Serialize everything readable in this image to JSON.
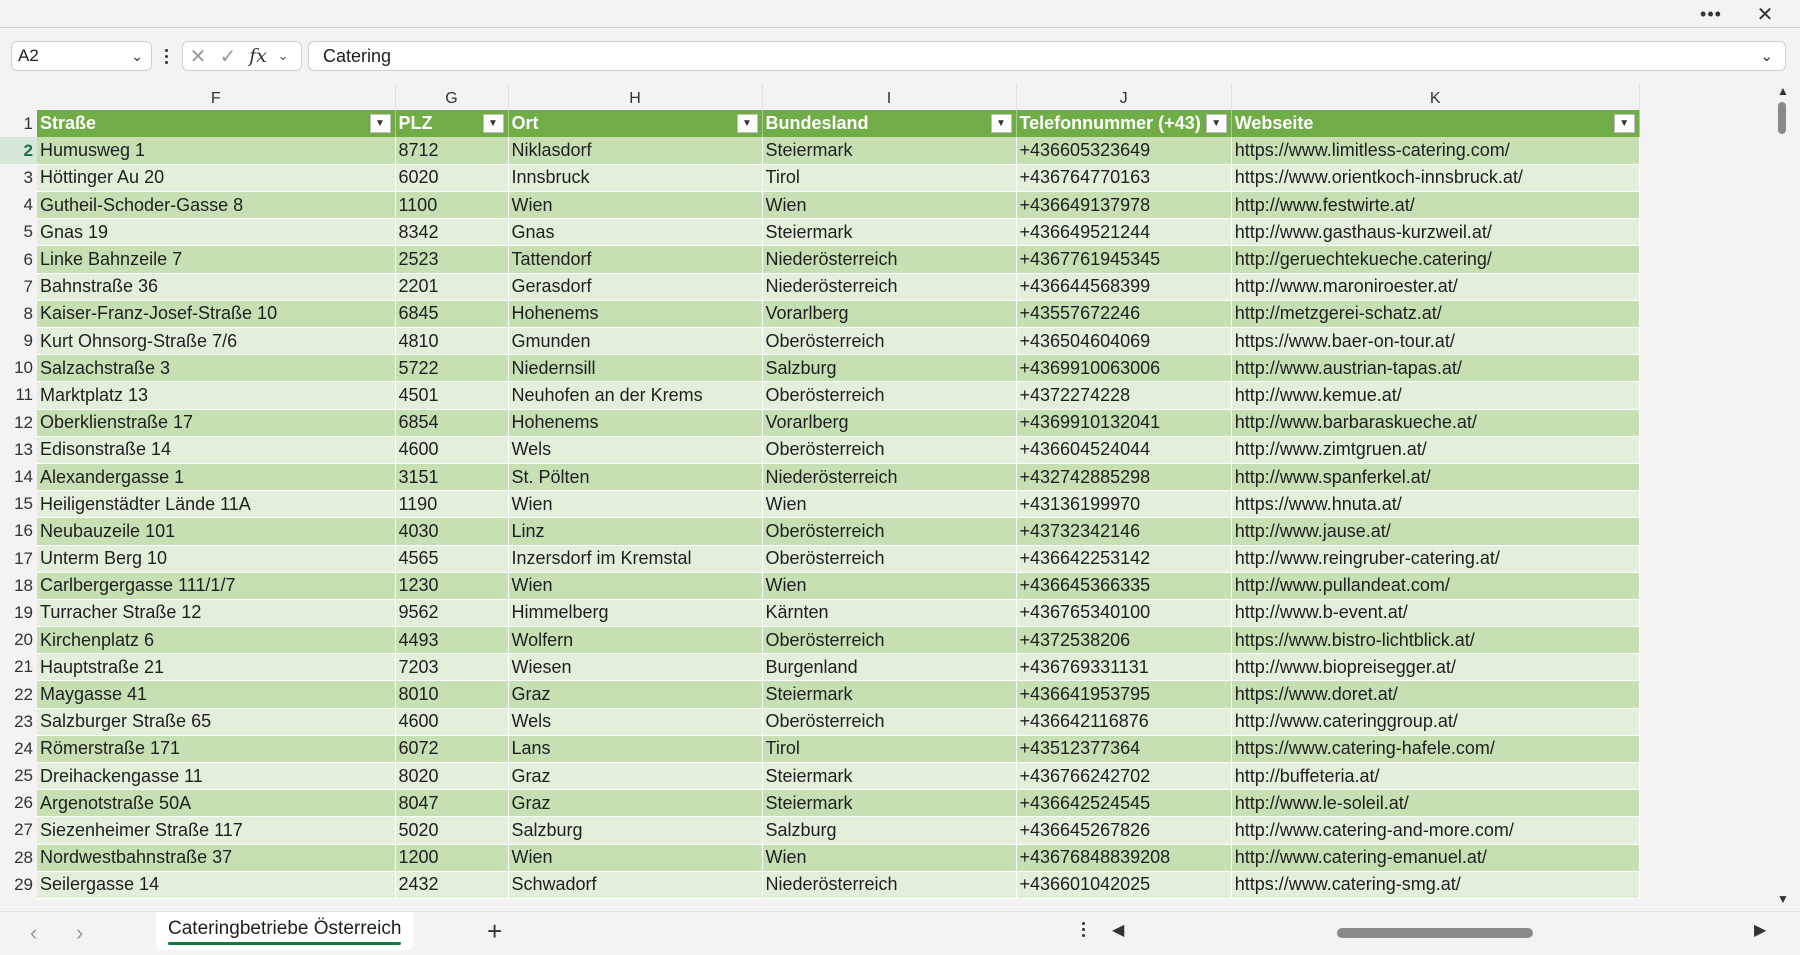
{
  "titlebar": {
    "more_icon": "more-horizontal-icon",
    "close_icon": "close-icon",
    "more_glyph": "•••",
    "close_glyph": "✕"
  },
  "formula_bar": {
    "name_box": "A2",
    "formula": "Catering",
    "cancel_glyph": "✕",
    "enter_glyph": "✓",
    "fx_label": "fx"
  },
  "columns": [
    "F",
    "G",
    "H",
    "I",
    "J",
    "K"
  ],
  "header_row": {
    "row_number": "1",
    "cells": [
      "Straße",
      "PLZ",
      "Ort",
      "Bundesland",
      "Telefonnummer (+43)",
      "Webseite"
    ]
  },
  "rows": [
    {
      "n": "2",
      "cells": [
        "Humusweg 1",
        "8712",
        "Niklasdorf",
        "Steiermark",
        "+436605323649",
        "https://www.limitless-catering.com/"
      ]
    },
    {
      "n": "3",
      "cells": [
        "Höttinger Au 20",
        "6020",
        "Innsbruck",
        "Tirol",
        "+436764770163",
        "https://www.orientkoch-innsbruck.at/"
      ]
    },
    {
      "n": "4",
      "cells": [
        "Gutheil-Schoder-Gasse 8",
        "1100",
        "Wien",
        "Wien",
        "+436649137978",
        "http://www.festwirte.at/"
      ]
    },
    {
      "n": "5",
      "cells": [
        "Gnas 19",
        "8342",
        "Gnas",
        "Steiermark",
        "+436649521244",
        "http://www.gasthaus-kurzweil.at/"
      ]
    },
    {
      "n": "6",
      "cells": [
        "Linke Bahnzeile 7",
        "2523",
        "Tattendorf",
        "Niederösterreich",
        "+4367761945345",
        "http://geruechtekueche.catering/"
      ]
    },
    {
      "n": "7",
      "cells": [
        "Bahnstraße 36",
        "2201",
        "Gerasdorf",
        "Niederösterreich",
        "+436644568399",
        "http://www.maroniroester.at/"
      ]
    },
    {
      "n": "8",
      "cells": [
        "Kaiser-Franz-Josef-Straße 10",
        "6845",
        "Hohenems",
        "Vorarlberg",
        "+43557672246",
        "http://metzgerei-schatz.at/"
      ]
    },
    {
      "n": "9",
      "cells": [
        "Kurt Ohnsorg-Straße 7/6",
        "4810",
        "Gmunden",
        "Oberösterreich",
        "+436504604069",
        "https://www.baer-on-tour.at/"
      ]
    },
    {
      "n": "10",
      "cells": [
        "Salzachstraße 3",
        "5722",
        "Niedernsill",
        "Salzburg",
        "+4369910063006",
        "http://www.austrian-tapas.at/"
      ]
    },
    {
      "n": "11",
      "cells": [
        "Marktplatz 13",
        "4501",
        "Neuhofen an der Krems",
        "Oberösterreich",
        "+4372274228",
        "http://www.kemue.at/"
      ]
    },
    {
      "n": "12",
      "cells": [
        "Oberklienstraße 17",
        "6854",
        "Hohenems",
        "Vorarlberg",
        "+4369910132041",
        "http://www.barbaraskueche.at/"
      ]
    },
    {
      "n": "13",
      "cells": [
        "Edisonstraße 14",
        "4600",
        "Wels",
        "Oberösterreich",
        "+436604524044",
        "http://www.zimtgruen.at/"
      ]
    },
    {
      "n": "14",
      "cells": [
        "Alexandergasse 1",
        "3151",
        "St. Pölten",
        "Niederösterreich",
        "+432742885298",
        "http://www.spanferkel.at/"
      ]
    },
    {
      "n": "15",
      "cells": [
        "Heiligenstädter Lände 11A",
        "1190",
        "Wien",
        "Wien",
        "+43136199970",
        "https://www.hnuta.at/"
      ]
    },
    {
      "n": "16",
      "cells": [
        "Neubauzeile 101",
        "4030",
        "Linz",
        "Oberösterreich",
        "+43732342146",
        "http://www.jause.at/"
      ]
    },
    {
      "n": "17",
      "cells": [
        "Unterm Berg 10",
        "4565",
        "Inzersdorf im Kremstal",
        "Oberösterreich",
        "+436642253142",
        "http://www.reingruber-catering.at/"
      ]
    },
    {
      "n": "18",
      "cells": [
        "Carlbergergasse 111/1/7",
        "1230",
        "Wien",
        "Wien",
        "+436645366335",
        "http://www.pullandeat.com/"
      ]
    },
    {
      "n": "19",
      "cells": [
        "Turracher Straße 12",
        "9562",
        "Himmelberg",
        "Kärnten",
        "+436765340100",
        "http://www.b-event.at/"
      ]
    },
    {
      "n": "20",
      "cells": [
        "Kirchenplatz 6",
        "4493",
        "Wolfern",
        "Oberösterreich",
        "+4372538206",
        "https://www.bistro-lichtblick.at/"
      ]
    },
    {
      "n": "21",
      "cells": [
        "Hauptstraße 21",
        "7203",
        "Wiesen",
        "Burgenland",
        "+436769331131",
        "http://www.biopreisegger.at/"
      ]
    },
    {
      "n": "22",
      "cells": [
        "Maygasse 41",
        "8010",
        "Graz",
        "Steiermark",
        "+436641953795",
        "https://www.doret.at/"
      ]
    },
    {
      "n": "23",
      "cells": [
        "Salzburger Straße 65",
        "4600",
        "Wels",
        "Oberösterreich",
        "+436642116876",
        "http://www.cateringgroup.at/"
      ]
    },
    {
      "n": "24",
      "cells": [
        "Römerstraße 171",
        "6072",
        "Lans",
        "Tirol",
        "+43512377364",
        "https://www.catering-hafele.com/"
      ]
    },
    {
      "n": "25",
      "cells": [
        "Dreihackengasse 11",
        "8020",
        "Graz",
        "Steiermark",
        "+436766242702",
        "http://buffeteria.at/"
      ]
    },
    {
      "n": "26",
      "cells": [
        "Argenotstraße 50A",
        "8047",
        "Graz",
        "Steiermark",
        "+436642524545",
        "http://www.le-soleil.at/"
      ]
    },
    {
      "n": "27",
      "cells": [
        "Siezenheimer Straße 117",
        "5020",
        "Salzburg",
        "Salzburg",
        "+436645267826",
        "http://www.catering-and-more.com/"
      ]
    },
    {
      "n": "28",
      "cells": [
        "Nordwestbahnstraße 37",
        "1200",
        "Wien",
        "Wien",
        "+43676848839208",
        "http://www.catering-emanuel.at/"
      ]
    },
    {
      "n": "29",
      "cells": [
        "Seilergasse 14",
        "2432",
        "Schwadorf",
        "Niederösterreich",
        "+436601042025",
        "https://www.catering-smg.at/"
      ]
    }
  ],
  "sheet_tabs": [
    {
      "label": "Cateringbetriebe Österreich",
      "active": true
    }
  ],
  "add_sheet_glyph": "+",
  "colors": {
    "header_green": "#70ad47",
    "band_dark": "#c6e0b4",
    "band_light": "#e2efda",
    "accent": "#107c41"
  }
}
